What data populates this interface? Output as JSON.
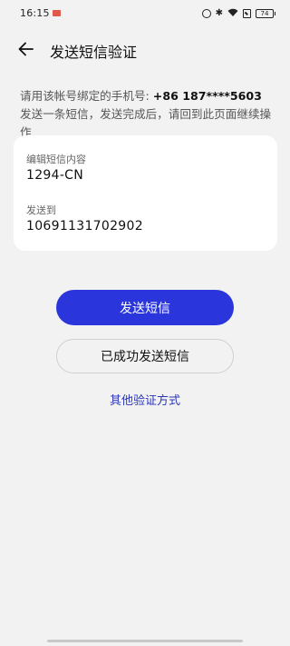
{
  "status_bar": {
    "time": "16:15",
    "battery": "74",
    "icons": [
      "game-notification-icon",
      "alarm-icon",
      "vibrate-icon",
      "wifi-icon",
      "sim-icon",
      "battery-icon"
    ]
  },
  "header": {
    "back_icon": "arrow-left-icon",
    "title": "发送短信验证"
  },
  "instruction": {
    "prefix": "请用该帐号绑定的手机号: ",
    "phone": "+86 187****5603",
    "suffix": " 发送一条短信，发送完成后，请回到此页面继续操作"
  },
  "sms_card": {
    "content_label": "编辑短信内容",
    "content_value": "1294-CN",
    "to_label": "发送到",
    "to_value": "10691131702902"
  },
  "actions": {
    "send_sms_label": "发送短信",
    "sent_success_label": "已成功发送短信",
    "other_methods_label": "其他验证方式"
  },
  "colors": {
    "primary": "#2a36db",
    "link": "#2a36b8",
    "background": "#f2f2f2",
    "card": "#ffffff"
  }
}
